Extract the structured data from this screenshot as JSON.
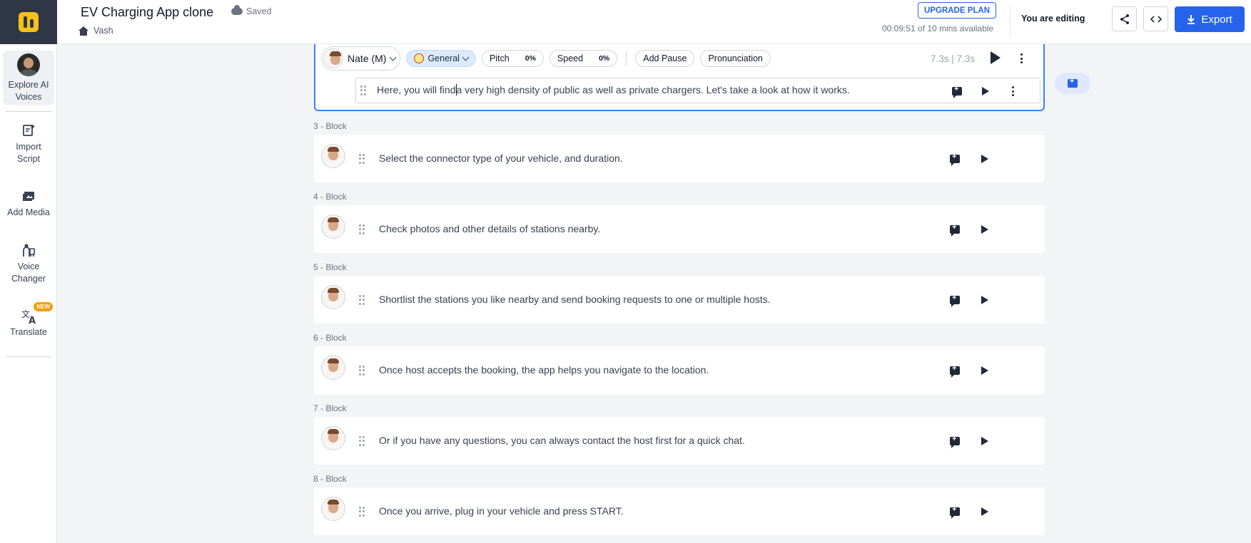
{
  "sidebar": {
    "items": [
      {
        "label_line1": "Explore AI",
        "label_line2": "Voices",
        "icon": "avatar"
      },
      {
        "label_line1": "Import",
        "label_line2": "Script",
        "icon": "import-script-icon"
      },
      {
        "label_line1": "Add Media",
        "label_line2": "",
        "icon": "media-icon"
      },
      {
        "label_line1": "Voice",
        "label_line2": "Changer",
        "icon": "voice-changer-icon"
      },
      {
        "label_line1": "Translate",
        "label_line2": "",
        "icon": "translate-icon",
        "badge": "NEW"
      }
    ]
  },
  "header": {
    "title": "EV Charging App clone",
    "saved_status": "Saved",
    "breadcrumb": "Vash",
    "upgrade_label": "UPGRADE PLAN",
    "minutes_text": "00:09:51 of 10 mins available",
    "editing_text": "You are editing",
    "export_label": "Export"
  },
  "active_block": {
    "voice": "Nate (M)",
    "style": "General",
    "pitch_label": "Pitch",
    "pitch_value": "0%",
    "speed_label": "Speed",
    "speed_value": "0%",
    "pause_label": "Add Pause",
    "pronunciation_label": "Pronunciation",
    "duration": "7.3s | 7.3s",
    "text_before_caret": "Here, you will find",
    "text_after_caret": "a very high density of public as well as private chargers. Let's take a look at how it works."
  },
  "blocks": [
    {
      "label": "3 -  Block",
      "text": "Select the connector type of your vehicle, and duration."
    },
    {
      "label": "4 -  Block",
      "text": "Check photos and other details of stations nearby."
    },
    {
      "label": "5 -  Block",
      "text": "Shortlist the stations you like nearby and send booking requests to one or multiple hosts."
    },
    {
      "label": "6 -  Block",
      "text": "Once host accepts the booking, the app helps you navigate to the location."
    },
    {
      "label": "7 -  Block",
      "text": "Or if you have any questions, you can always contact the host first for a quick chat."
    },
    {
      "label": "8 -  Block",
      "text": "Once you arrive, plug in your vehicle and press START."
    }
  ],
  "colors": {
    "accent": "#2563eb",
    "logo_bg": "#2f3747",
    "logo_mark": "#f7c11a",
    "badge": "#f59e0b"
  }
}
